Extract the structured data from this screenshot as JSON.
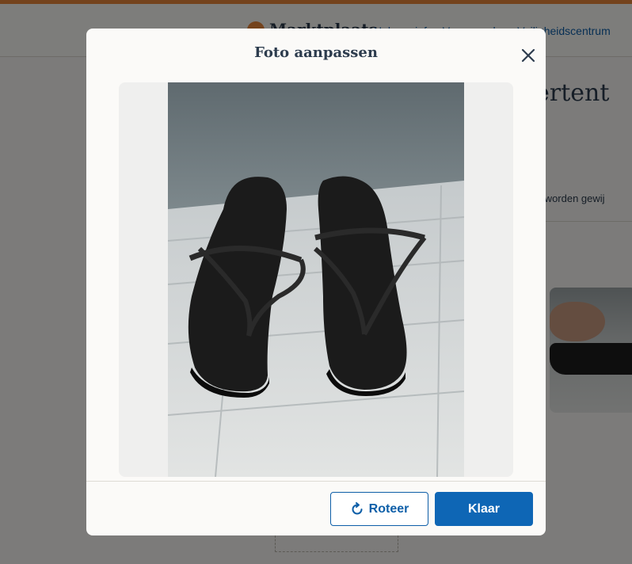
{
  "background_page": {
    "site_name": "Marktplaats",
    "nav_links": [
      "Help en info",
      "Voorwaarden",
      "Veiligheidscentrum"
    ],
    "heading_fragment": "dvertent",
    "note_fragment": "et meer worden gewij"
  },
  "modal": {
    "title": "Foto aanpassen",
    "close_icon": "close-icon",
    "photo_subject": "black sandals",
    "rotate_button": {
      "label": "Roteer",
      "icon": "rotate-icon"
    },
    "done_button": {
      "label": "Klaar"
    }
  },
  "colors": {
    "accent_orange": "#e8863a",
    "primary_blue": "#0e66b5",
    "text_dark": "#2d3c4e"
  }
}
